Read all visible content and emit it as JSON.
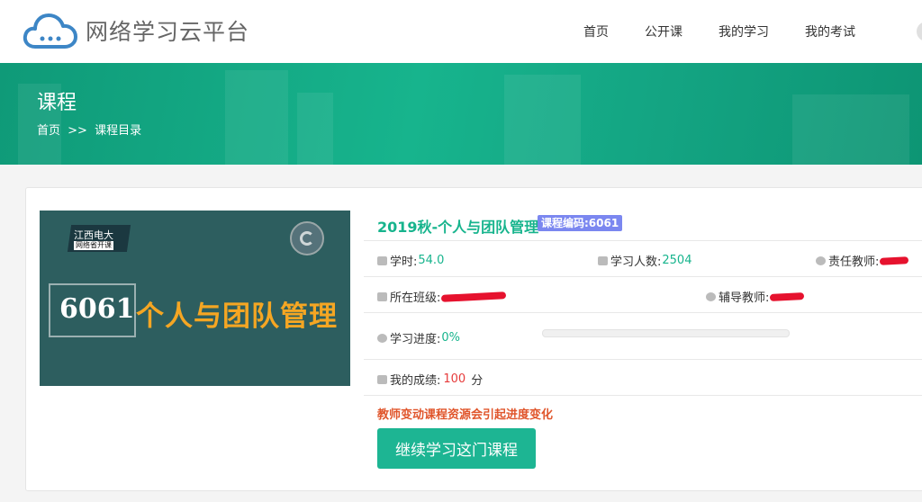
{
  "header": {
    "logo_text": "网络学习云平台",
    "nav": [
      "首页",
      "公开课",
      "我的学习",
      "我的考试"
    ]
  },
  "banner": {
    "title": "课程",
    "breadcrumb": [
      "首页",
      ">>",
      "课程目录"
    ]
  },
  "course": {
    "cover": {
      "tag_line1": "江西电大",
      "tag_line2": "网络省开课",
      "code": "6061",
      "name": "个人与团队管理"
    },
    "title": "2019秋-个人与团队管理",
    "code_badge": "课程编码:6061",
    "hours_label": "学时:",
    "hours_value": "54.0",
    "learners_label": "学习人数:",
    "learners_value": "2504",
    "teacher_label": "责任教师:",
    "class_label": "所在班级:",
    "tutor_label": "辅导教师:",
    "progress_label": "学习进度:",
    "progress_value": "0%",
    "progress_fraction": 0,
    "score_label": "我的成绩:",
    "score_value": "100",
    "score_unit": "分",
    "notice": "教师变动课程资源会引起进度变化",
    "continue_button": "继续学习这门课程"
  },
  "colors": {
    "accent": "#17b48d",
    "badge": "#7b87f0",
    "notice": "#e0552b",
    "score": "#e63b3b",
    "redaction": "#e6122e"
  },
  "icons": [
    "cloud-logo-icon",
    "calendar-icon",
    "users-icon",
    "user-icon",
    "clock-icon",
    "score-icon"
  ]
}
